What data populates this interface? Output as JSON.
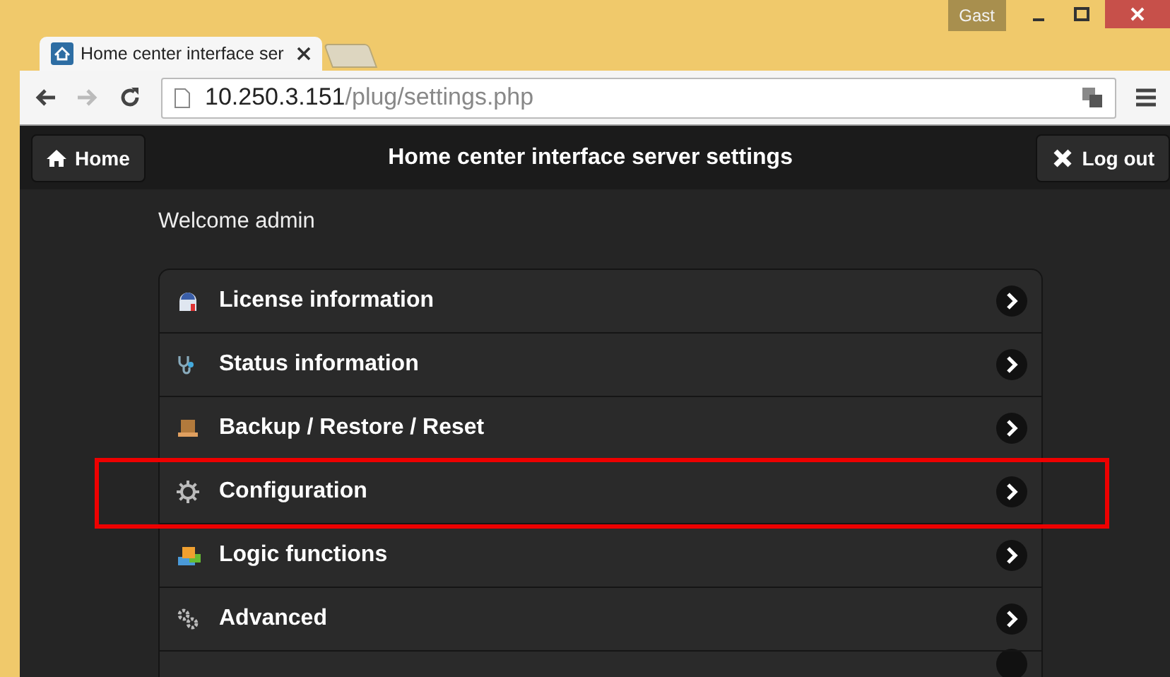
{
  "window": {
    "user_badge": "Gast"
  },
  "tabs": [
    {
      "title": "Home center interface ser",
      "selected": true
    }
  ],
  "address_bar": {
    "host": "10.250.3.151",
    "path": "/plug/settings.php"
  },
  "header": {
    "home_button": "Home",
    "title": "Home center interface server settings",
    "logout_button": "Log out"
  },
  "welcome": "Welcome admin",
  "menu": [
    {
      "label": "License information",
      "highlighted": false
    },
    {
      "label": "Status information",
      "highlighted": false
    },
    {
      "label": "Backup / Restore / Reset",
      "highlighted": false
    },
    {
      "label": "Configuration",
      "highlighted": true
    },
    {
      "label": "Logic functions",
      "highlighted": false
    },
    {
      "label": "Advanced",
      "highlighted": false
    }
  ]
}
